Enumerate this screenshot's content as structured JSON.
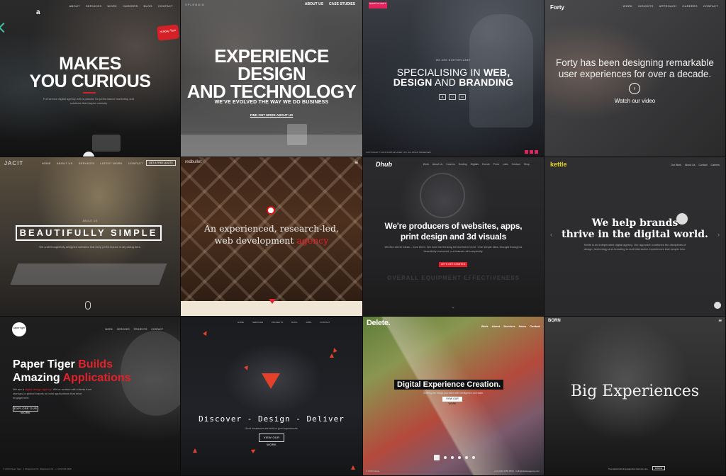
{
  "tiles": {
    "t1": {
      "logo": "a",
      "nav": [
        "About",
        "Services",
        "Work",
        "Careers",
        "Blog",
        "Contact"
      ],
      "hero_line1": "MAKES",
      "hero_line2": "YOU CURIOUS",
      "sub": "Full service digital agency with a passion for performance marketing and solutions that inspire curiosity",
      "badge": "Holiday Toys"
    },
    "t2": {
      "brand": "SPLENDID",
      "nav": [
        "ABOUT US",
        "CASE STUDIES"
      ],
      "hero_line1": "EXPERIENCE DESIGN",
      "hero_line2": "AND TECHNOLOGY",
      "sub": "WE'VE EVOLVED THE WAY WE DO BUSINESS",
      "link": "FIND OUT MORE ABOUT US"
    },
    "t3": {
      "logo": "NORTH PLANET",
      "tag": "WE ARE NORTHPLANET",
      "hero_line1_plain": "SPECIALISING IN ",
      "hero_line1_bold": "WEB,",
      "hero_line2_bold1": "DESIGN",
      "hero_line2_plain": " AND ",
      "hero_line2_bold2": "BRANDING",
      "icons": [
        "A",
        "□",
        "▭"
      ],
      "footer": "COPYRIGHT © 2015 NORTHPLANET LTD. ALL RIGHT RESERVED"
    },
    "t4": {
      "logo": "Forty",
      "nav": [
        "WORK",
        "INSIGHTS",
        "APPROACH",
        "CAREERS",
        "CONTACT"
      ],
      "hero": "Forty has been designing remarkable user experiences for over a decade.",
      "play": "›",
      "watch": "Watch our video"
    },
    "t5": {
      "logo": "JACIT",
      "nav": [
        "HOME",
        "ABOUT US",
        "SERVICES",
        "LATEST WORK",
        "CONTACT"
      ],
      "quote": "GET A FREE QUOTE",
      "tag": "ABOUT US",
      "hero": "BEAUTIFULLY SIMPLE",
      "sub": "We craft thoughtfully designed websites that keep performance in all pricing tiers."
    },
    "t6": {
      "logo": "redbullet",
      "menu": "≡",
      "hero_line1": "An experienced, research-led,",
      "hero_line2_plain": "web development ",
      "hero_line2_accent": "agency"
    },
    "t7": {
      "logo": "Dhub",
      "nav": [
        "Work",
        "About Us",
        "Careers",
        "Hosting",
        "Digitals",
        "Events",
        "Porto",
        "Labs",
        "Contact",
        "Shop"
      ],
      "hero_line1": "We're producers of websites, apps,",
      "hero_line2": "print design and 3d visuals",
      "sub": "We like clever ideas – love them. We love the thinking behind them more. One simple idea, thought through & beautifully executed, out-classes all complexity.",
      "btn": "LET'S GET STARTED",
      "faint": "OVERALL EQUIPMENT EFFECTIVENESS"
    },
    "t8": {
      "logo": "kettle",
      "nav": [
        "Our Work",
        "About Us",
        "Contact",
        "Careers"
      ],
      "hero_line1": "We help brands",
      "hero_line2": "thrive in the digital world.",
      "sub": "Kettle is an independent digital agency. Our approach combines the disciplines of design, technology and branding to craft interactive experiences that people love."
    },
    "t9": {
      "logo": "paper tiger",
      "nav": [
        "WORK",
        "SERVICES",
        "PROJECTS",
        "CONTACT"
      ],
      "hero_w1": "Paper Tiger ",
      "hero_w2": "Builds",
      "hero_w3": "Amazing ",
      "hero_w4": "Applications",
      "sub_pre": "We are a ",
      "sub_red": "digital design agency",
      "sub_post": ". We've worked with clients from startups to global brands to build applications that drive engagement.",
      "btn": "EXPLORE OUR WORK",
      "footer": "© 2015 Paper Tiger · 1 Ridgewood Dr, Ridgewood NJ · +1 201.526.4398"
    },
    "t10": {
      "nav": [
        "HOME",
        "SERVICES",
        "PROJECTS",
        "BLOG",
        "JOBS",
        "CONTACT"
      ],
      "hero": "Discover - Design - Deliver",
      "sub": "Good businesses are built on good experiences.",
      "btn": "VIEW OUR WORK"
    },
    "t11": {
      "logo": "Delete.",
      "nav": [
        "Work",
        "About",
        "Services",
        "News",
        "Contact"
      ],
      "hero": "Digital Experience Creation.",
      "sub": "Crafting the things you want with intelligence and taste.",
      "btn": "VIEW OUR WORK",
      "footer": "© 2015 Delete",
      "footer_r": "+44 (0)20 3355 8840 · hello@deleteagency.com"
    },
    "t12": {
      "logo": "BORN",
      "menu": "≡",
      "hero": "Big Experiences",
      "footer": "Two award winning agencies become one",
      "btn": "MORE"
    }
  }
}
